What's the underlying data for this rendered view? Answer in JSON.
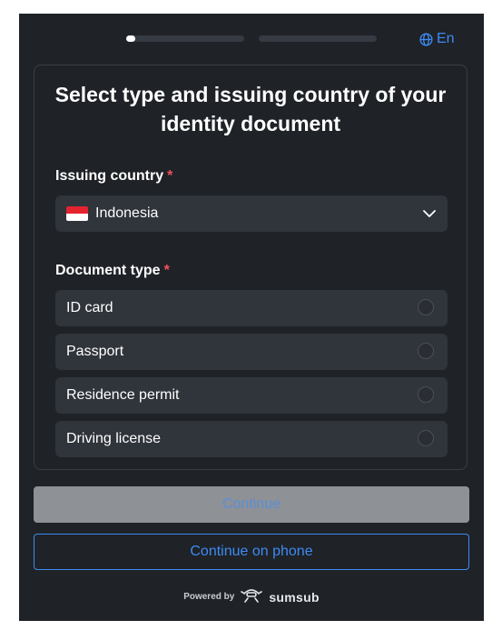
{
  "header": {
    "progress": [
      0.08,
      0.0
    ],
    "language": "En"
  },
  "card": {
    "title": "Select type and issuing country of your identity document",
    "issuing_country": {
      "label": "Issuing country",
      "required_mark": "*",
      "value": "Indonesia",
      "flag_icon": "indonesia-flag-icon"
    },
    "document_type": {
      "label": "Document type",
      "required_mark": "*",
      "options": [
        {
          "label": "ID card",
          "selected": false
        },
        {
          "label": "Passport",
          "selected": false
        },
        {
          "label": "Residence permit",
          "selected": false
        },
        {
          "label": "Driving license",
          "selected": false
        }
      ]
    }
  },
  "actions": {
    "continue_label": "Continue",
    "continue_disabled": true,
    "continue_phone_label": "Continue on phone"
  },
  "footer": {
    "powered_by": "Powered by",
    "brand": "sumsub"
  },
  "colors": {
    "background": "#1f2227",
    "accent": "#3d8bf2",
    "required": "#f0525a",
    "field": "#30343b"
  }
}
